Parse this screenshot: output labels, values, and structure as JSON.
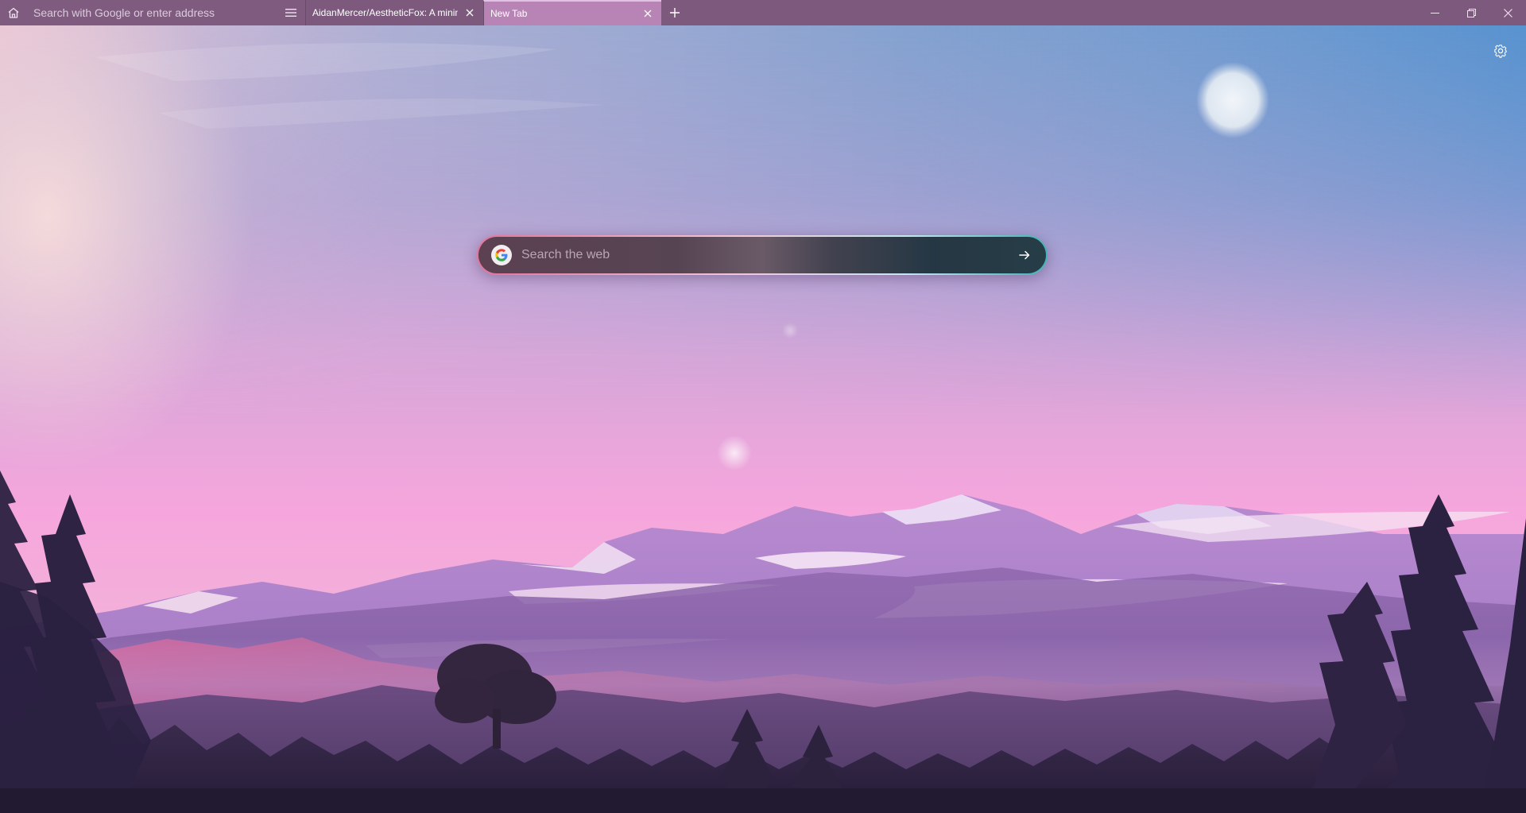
{
  "toolbar": {
    "home_icon": "home-icon",
    "address_placeholder": "Search with Google or enter address",
    "menu_icon": "hamburger-menu-icon"
  },
  "tabs": [
    {
      "title": "AidanMercer/AestheticFox: A minimal",
      "active": false,
      "close_icon": "close-icon"
    },
    {
      "title": "New Tab",
      "active": true,
      "close_icon": "close-icon"
    }
  ],
  "new_tab_icon": "plus-icon",
  "window_controls": {
    "minimize_icon": "minimize-icon",
    "restore_icon": "restore-icon",
    "close_icon": "close-icon"
  },
  "newtab_page": {
    "settings_icon": "gear-icon",
    "search_placeholder": "Search the web",
    "search_engine_icon": "google-icon",
    "submit_icon": "arrow-right-icon"
  },
  "colors": {
    "toolbar_bg": "#7d5a7d",
    "active_tab_bg": "#b883b5",
    "sky_top": "#5f8fc8",
    "sky_pink": "#f4a9dc"
  }
}
